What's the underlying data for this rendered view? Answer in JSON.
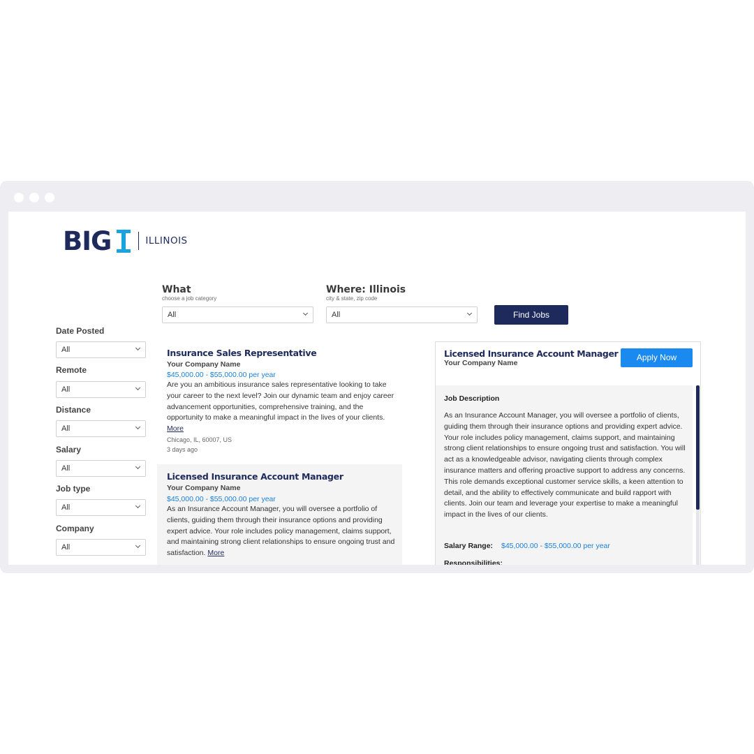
{
  "logo": {
    "brand": "BIG",
    "letter": "I",
    "state": "ILLINOIS"
  },
  "search": {
    "what_label": "What",
    "what_hint": "choose a job category",
    "what_value": "All",
    "where_label": "Where: Illinois",
    "where_hint": "city & state, zip code",
    "where_value": "All",
    "find_button": "Find Jobs"
  },
  "filters": [
    {
      "label": "Date Posted",
      "value": "All"
    },
    {
      "label": "Remote",
      "value": "All"
    },
    {
      "label": "Distance",
      "value": "All"
    },
    {
      "label": "Salary",
      "value": "All"
    },
    {
      "label": "Job type",
      "value": "All"
    },
    {
      "label": "Company",
      "value": "All"
    }
  ],
  "jobs": [
    {
      "title": "Insurance Sales Representative",
      "company": "Your Company Name",
      "salary": "$45,000.00 - $55,000.00 per year",
      "description": "Are you an ambitious insurance sales representative looking to take your career to the next level? Join our dynamic team and enjoy career advancement opportunities, comprehensive training, and the opportunity to make a meaningful impact in the lives of your clients.",
      "more": "More",
      "location": "Chicago, IL, 60007, US",
      "posted": "3 days ago"
    },
    {
      "title": "Licensed Insurance Account Manager",
      "company": "Your Company Name",
      "salary": "$45,000.00 - $55,000.00 per year",
      "description": "As an Insurance Account Manager, you will oversee a portfolio of clients, guiding them through their insurance options and providing expert advice. Your role includes policy management, claims support, and maintaining strong client relationships to ensure ongoing trust and satisfaction.",
      "more": "More"
    }
  ],
  "detail": {
    "title": "Licensed Insurance Account Manager",
    "company": "Your Company Name",
    "apply_button": "Apply Now",
    "section_title": "Job Description",
    "description": "As an Insurance Account Manager, you will oversee a portfolio of clients, guiding them through their insurance options and providing expert advice. Your role includes policy management, claims support, and maintaining strong client relationships to ensure ongoing trust and satisfaction. You will act as a knowledgeable advisor, navigating clients through complex insurance matters and offering proactive support to address any concerns. This role demands exceptional customer service skills, a keen attention to detail, and the ability to effectively communicate and build rapport with clients. Join our team and leverage your expertise to make a meaningful impact in the lives of our clients.",
    "salary_label": "Salary Range:",
    "salary_value": "$45,000.00 - $55,000.00 per year",
    "responsibilities_label": "Responsibilities:"
  },
  "colors": {
    "navy": "#1f2a5c",
    "logo_accent": "#1aa3dd",
    "apply_blue": "#1a8af0",
    "salary_blue": "#1a7fd6"
  }
}
